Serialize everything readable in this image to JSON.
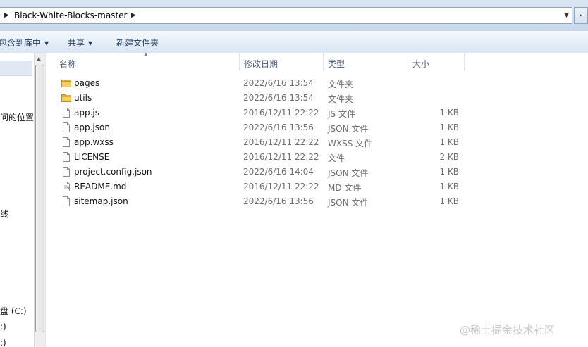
{
  "address": {
    "path": "Black-White-Blocks-master"
  },
  "toolbar": {
    "include_label": "包含到库中",
    "share_label": "共享",
    "new_folder_label": "新建文件夹"
  },
  "nav": {
    "items": [
      "问的位置",
      "线",
      "盘 (C:)",
      ":)",
      ":)"
    ]
  },
  "columns": {
    "name": "名称",
    "modified": "修改日期",
    "type": "类型",
    "size": "大小"
  },
  "files": [
    {
      "name": "pages",
      "date": "2022/6/16 13:54",
      "type": "文件夹",
      "size": "",
      "icon": "folder-icon"
    },
    {
      "name": "utils",
      "date": "2022/6/16 13:54",
      "type": "文件夹",
      "size": "",
      "icon": "folder-icon"
    },
    {
      "name": "app.js",
      "date": "2016/12/11 22:22",
      "type": "JS 文件",
      "size": "1 KB",
      "icon": "file-icon"
    },
    {
      "name": "app.json",
      "date": "2022/6/16 13:56",
      "type": "JSON 文件",
      "size": "1 KB",
      "icon": "file-icon"
    },
    {
      "name": "app.wxss",
      "date": "2016/12/11 22:22",
      "type": "WXSS 文件",
      "size": "1 KB",
      "icon": "file-icon"
    },
    {
      "name": "LICENSE",
      "date": "2016/12/11 22:22",
      "type": "文件",
      "size": "2 KB",
      "icon": "file-icon"
    },
    {
      "name": "project.config.json",
      "date": "2022/6/16 14:04",
      "type": "JSON 文件",
      "size": "1 KB",
      "icon": "file-icon"
    },
    {
      "name": "README.md",
      "date": "2016/12/11 22:22",
      "type": "MD 文件",
      "size": "1 KB",
      "icon": "document-icon"
    },
    {
      "name": "sitemap.json",
      "date": "2022/6/16 13:56",
      "type": "JSON 文件",
      "size": "1 KB",
      "icon": "file-icon"
    }
  ],
  "watermark": "@稀土掘金技术社区"
}
